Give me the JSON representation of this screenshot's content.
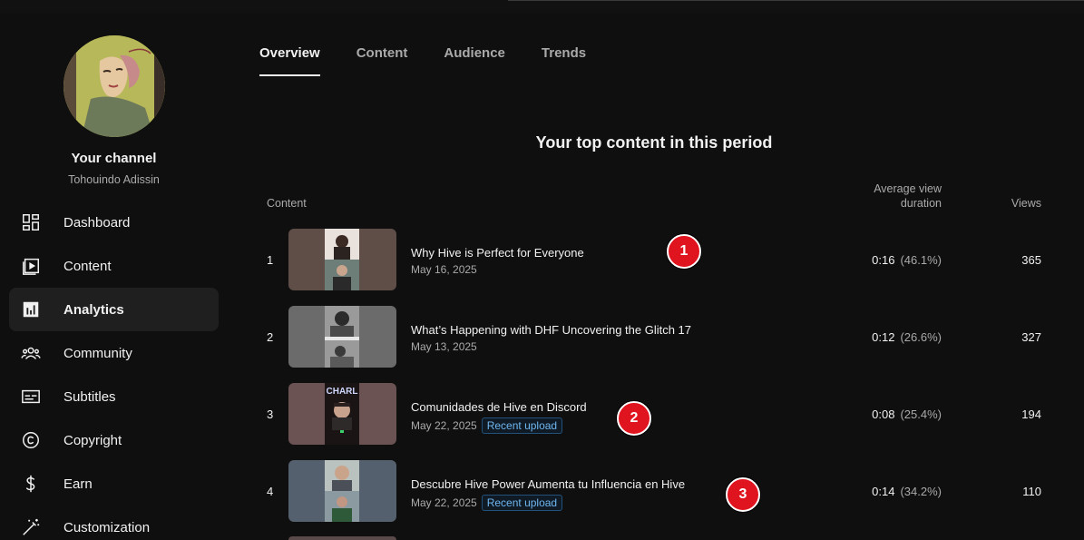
{
  "channel": {
    "title": "Your channel",
    "name": "Tohouindo Adissin"
  },
  "nav": {
    "items": [
      {
        "label": "Dashboard",
        "icon": "dashboard-icon"
      },
      {
        "label": "Content",
        "icon": "content-icon"
      },
      {
        "label": "Analytics",
        "icon": "analytics-icon",
        "active": true
      },
      {
        "label": "Community",
        "icon": "community-icon"
      },
      {
        "label": "Subtitles",
        "icon": "subtitles-icon"
      },
      {
        "label": "Copyright",
        "icon": "copyright-icon"
      },
      {
        "label": "Earn",
        "icon": "earn-icon"
      },
      {
        "label": "Customization",
        "icon": "customization-icon"
      }
    ]
  },
  "tabs": [
    {
      "label": "Overview",
      "active": true
    },
    {
      "label": "Content"
    },
    {
      "label": "Audience"
    },
    {
      "label": "Trends"
    }
  ],
  "section_title": "Your top content in this period",
  "table": {
    "col_content": "Content",
    "col_avd": "Average view duration",
    "col_views": "Views",
    "rows": [
      {
        "rank": "1",
        "title": "Why Hive is Perfect for Everyone",
        "date": "May 16, 2025",
        "badge": "",
        "avd": "0:16",
        "pct": "(46.1%)",
        "views": "365"
      },
      {
        "rank": "2",
        "title": "What’s Happening with DHF Uncovering the Glitch 17",
        "date": "May 13, 2025",
        "badge": "",
        "avd": "0:12",
        "pct": "(26.6%)",
        "views": "327"
      },
      {
        "rank": "3",
        "title": "Comunidades de Hive en Discord",
        "date": "May 22, 2025",
        "badge": "Recent upload",
        "avd": "0:08",
        "pct": "(25.4%)",
        "views": "194"
      },
      {
        "rank": "4",
        "title": "Descubre Hive Power Aumenta tu Influencia en Hive",
        "date": "May 22, 2025",
        "badge": "Recent upload",
        "avd": "0:14",
        "pct": "(34.2%)",
        "views": "110"
      }
    ]
  },
  "markers": [
    "1",
    "2",
    "3"
  ],
  "thumb_overlay_text": "CHARL",
  "colors": {
    "background": "#0f0f0f",
    "marker": "#e0141e",
    "badge_text": "#6fb6f0"
  }
}
